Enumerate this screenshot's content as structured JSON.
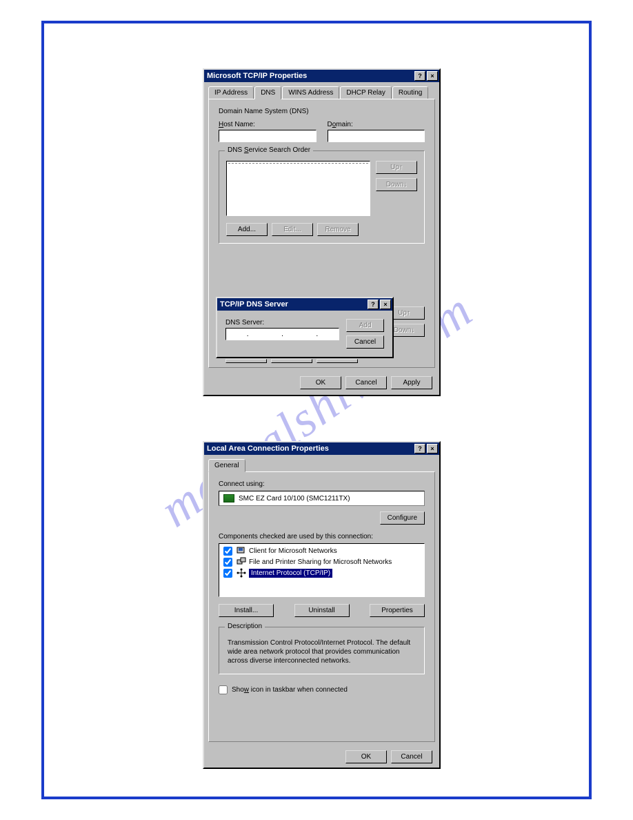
{
  "watermark": "manualshive.com",
  "tcpip": {
    "title": "Microsoft TCP/IP Properties",
    "tabs": [
      "IP Address",
      "DNS",
      "WINS Address",
      "DHCP Relay",
      "Routing"
    ],
    "section_title": "Domain Name System (DNS)",
    "host_label": "Host Name:",
    "domain_label": "Domain:",
    "search_order_label": "DNS Service Search Order",
    "btn_up": "Up↑",
    "btn_down": "Down↓",
    "btn_add": "Add...",
    "btn_edit": "Edit...",
    "btn_remove": "Remove",
    "sub": {
      "title": "TCP/IP DNS Server",
      "label": "DNS Server:",
      "btn_add": "Add",
      "btn_cancel": "Cancel"
    },
    "suffix_up": "Up↑",
    "suffix_down": "Down↓",
    "btn_ok": "OK",
    "btn_cancel": "Cancel",
    "btn_apply": "Apply"
  },
  "lan": {
    "title": "Local Area Connection Properties",
    "tab": "General",
    "connect_using": "Connect using:",
    "adapter": "SMC EZ Card 10/100 (SMC1211TX)",
    "btn_configure": "Configure",
    "components_label": "Components checked are used by this connection:",
    "components": [
      {
        "label": "Client for Microsoft Networks",
        "checked": true
      },
      {
        "label": "File and Printer Sharing for Microsoft Networks",
        "checked": true
      },
      {
        "label": "Internet Protocol (TCP/IP)",
        "checked": true,
        "selected": true
      }
    ],
    "btn_install": "Install...",
    "btn_uninstall": "Uninstall",
    "btn_properties": "Properties",
    "desc_label": "Description",
    "desc_text": "Transmission Control Protocol/Internet Protocol. The default wide area network protocol that provides communication across diverse interconnected networks.",
    "show_icon": "Show icon in taskbar when connected",
    "btn_ok": "OK",
    "btn_cancel": "Cancel"
  }
}
